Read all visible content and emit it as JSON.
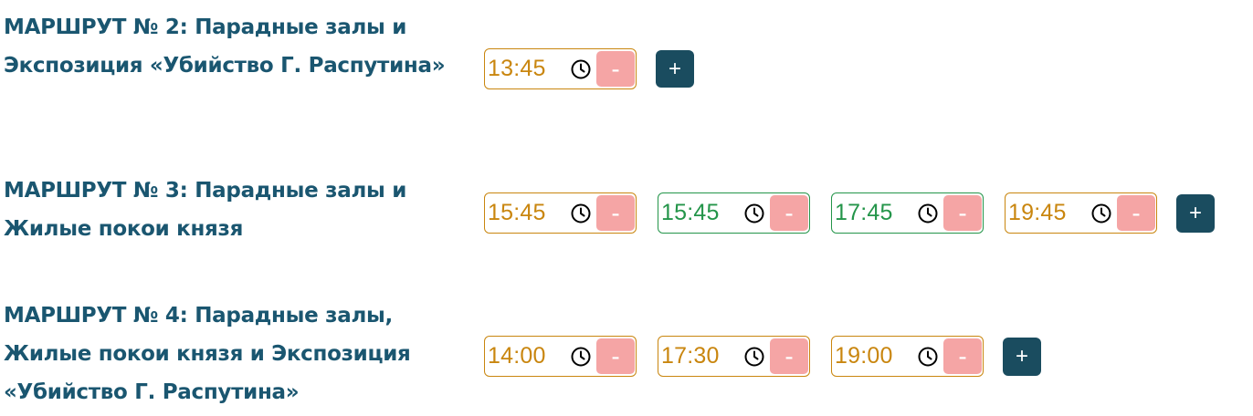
{
  "routes": [
    {
      "title": "МАРШРУТ № 2: Парадные залы и Экспозиция «Убийство Г. Распутина»",
      "times": [
        {
          "value": "13:45",
          "status": "orange"
        }
      ],
      "minus_label": "-",
      "add_label": "+"
    },
    {
      "title": "МАРШРУТ № 3: Парадные залы и Жилые покои князя",
      "times": [
        {
          "value": "15:45",
          "status": "orange"
        },
        {
          "value": "15:45",
          "status": "green"
        },
        {
          "value": "17:45",
          "status": "green"
        },
        {
          "value": "19:45",
          "status": "orange"
        }
      ],
      "minus_label": "-",
      "add_label": "+"
    },
    {
      "title": "МАРШРУТ № 4: Парадные залы, Жилые покои князя и Экспозиция «Убийство Г. Распутина»",
      "times": [
        {
          "value": "14:00",
          "status": "orange"
        },
        {
          "value": "17:30",
          "status": "orange"
        },
        {
          "value": "19:00",
          "status": "orange"
        }
      ],
      "minus_label": "-",
      "add_label": "+"
    }
  ],
  "colors": {
    "title": "#1a5670",
    "orange": "#c9860f",
    "green": "#24954a",
    "minus_bg": "#f5a5a5",
    "add_bg": "#1a4c5f"
  },
  "icons": {
    "time": "clock-icon"
  }
}
